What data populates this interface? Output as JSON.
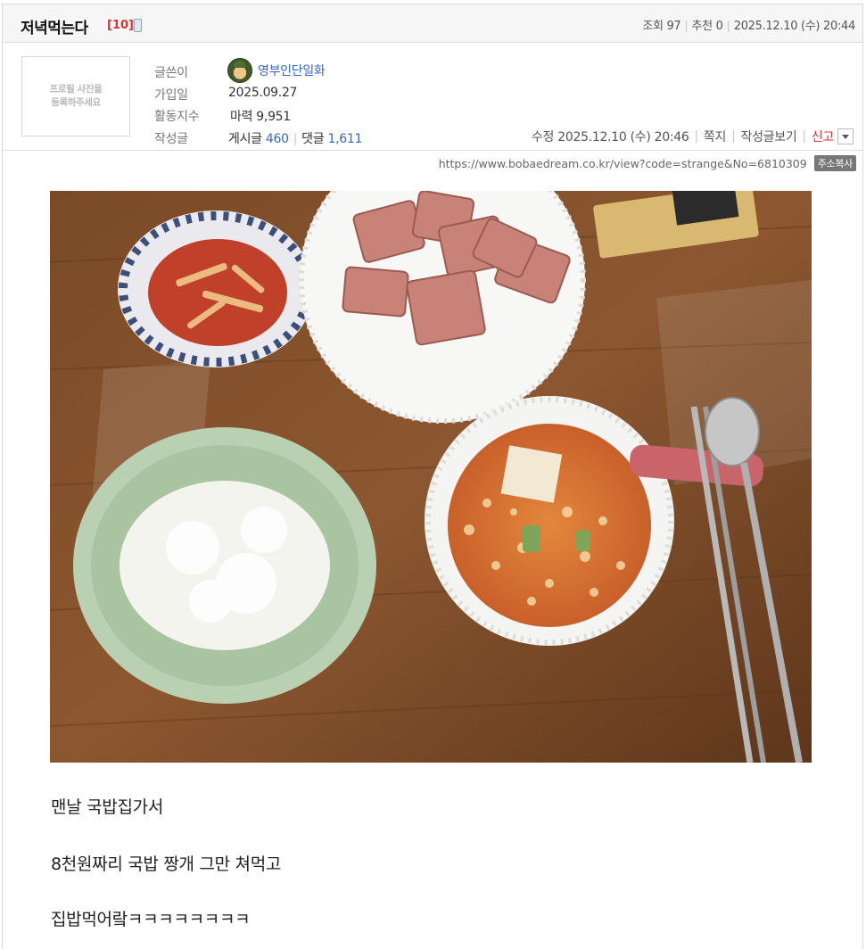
{
  "post": {
    "title": "저녁먹는다",
    "comment_count": "[10]",
    "views_label": "조회 97",
    "recommend_label": "추천 0",
    "datetime": "2025.12.10 (수) 20:44"
  },
  "author": {
    "profile_placeholder": "프로필 사진을\n등록하주세요",
    "labels": {
      "writer": "글쓴이",
      "joined": "가입일",
      "activity": "활동지수",
      "posts": "작성글"
    },
    "nickname": "영부인단일화",
    "joined_date": "2025.09.27",
    "activity_value": "마력 9,951",
    "posts_label": "게시글",
    "posts_count": "460",
    "comments_label": "댓글",
    "comments_count": "1,611"
  },
  "actions": {
    "edited": "수정 2025.12.10 (수) 20:46",
    "message": "쪽지",
    "view_posts": "작성글보기",
    "report": "신고"
  },
  "url": {
    "text": "https://www.bobaedream.co.kr/view?code=strange&No=6810309",
    "copy_label": "주소복사"
  },
  "body": {
    "lines": [
      "맨날 국밥집가서",
      "8천원짜리 국밥 짱개 그만 쳐먹고",
      "집밥먹어랔ㅋㅋㅋㅋㅋㅋㅋㅋ"
    ]
  },
  "colors": {
    "accent_blue": "#3366cc",
    "accent_red": "#e0322b"
  }
}
